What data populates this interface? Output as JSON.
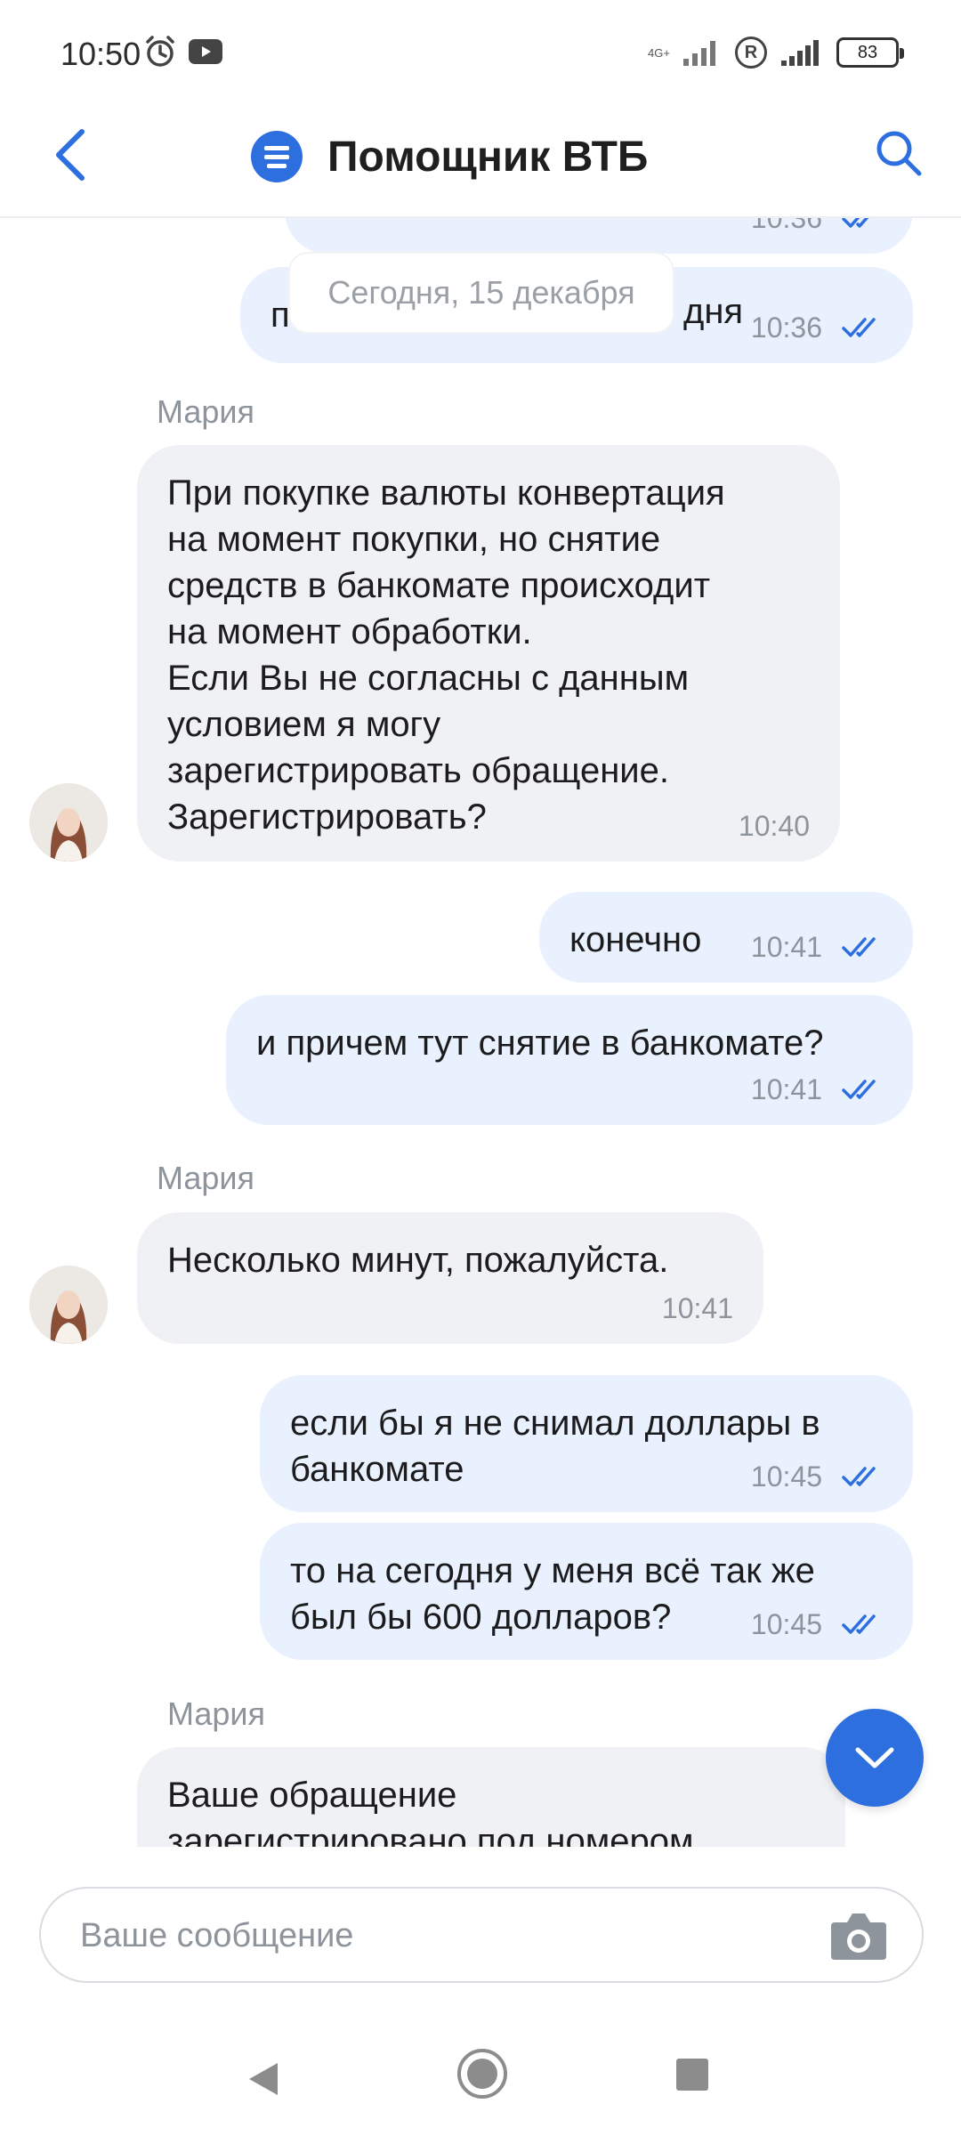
{
  "status_bar": {
    "time": "10:50",
    "network": "4G+",
    "roaming": "R",
    "battery": "83"
  },
  "header": {
    "title": "Помощник ВТБ"
  },
  "chat": {
    "date_separator": "Сегодня, 15 декабря",
    "partial_top": {
      "time": "10:36"
    },
    "partial_second": {
      "text_visible": "п",
      "text_visible_end": "дня",
      "time": "10:36"
    },
    "msg1": {
      "sender": "Мария",
      "lines": [
        "При покупке валюты конвертация",
        "на момент покупки, но снятие",
        "средств в банкомате происходит",
        "на момент обработки.",
        "Если Вы не согласны с данным",
        "условием я могу",
        "зарегистрировать обращение.",
        "Зарегистрировать?"
      ],
      "time": "10:40"
    },
    "msg2": {
      "text": "конечно",
      "time": "10:41"
    },
    "msg3": {
      "text": "и причем тут снятие в банкомате?",
      "time": "10:41"
    },
    "msg4": {
      "sender": "Мария",
      "text": "Несколько минут, пожалуйста.",
      "time": "10:41"
    },
    "msg5": {
      "lines": [
        "если бы я не снимал доллары в",
        "банкомате"
      ],
      "time": "10:45"
    },
    "msg6": {
      "lines": [
        "то на сегодня у меня всё так же",
        "был бы 600 долларов?"
      ],
      "time": "10:45"
    },
    "msg7": {
      "sender": "Мария",
      "lines": [
        "Ваше обращение",
        "зарегистрировано под номером"
      ]
    }
  },
  "composer": {
    "placeholder": "Ваше сообщение"
  },
  "colors": {
    "accent": "#2e6fe0",
    "outgoing_bubble": "#e8f1fd",
    "incoming_bubble": "#f0f1f5"
  }
}
